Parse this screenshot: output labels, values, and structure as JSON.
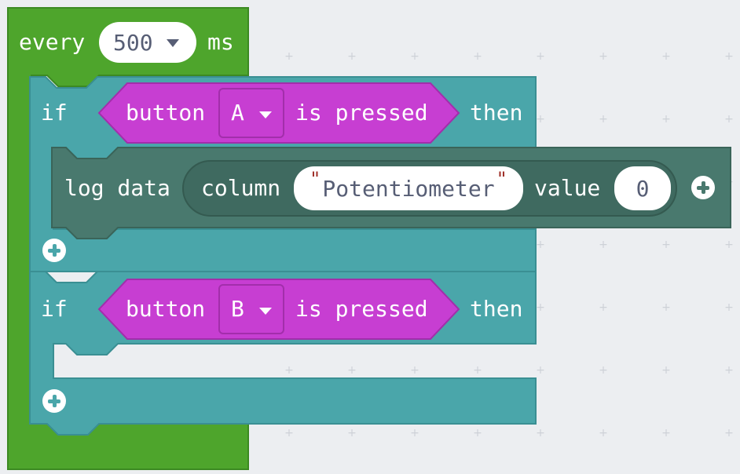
{
  "every_block": {
    "label": "every",
    "interval": "500",
    "unit": "ms"
  },
  "if_blocks": [
    {
      "if_label": "if",
      "then_label": "then",
      "condition": {
        "button_label": "button",
        "button_value": "A",
        "pressed_label": "is pressed"
      }
    },
    {
      "if_label": "if",
      "then_label": "then",
      "condition": {
        "button_label": "button",
        "button_value": "B",
        "pressed_label": "is pressed"
      }
    }
  ],
  "log_block": {
    "label": "log data",
    "column_label": "column",
    "column_value": "Potentiometer",
    "value_label": "value",
    "value_value": "0"
  },
  "colors": {
    "loops": "#4ea52c",
    "logic": "#4aa6aa",
    "input": "#c73ed2",
    "log": "#49796e",
    "workspace": "#eceef1"
  }
}
